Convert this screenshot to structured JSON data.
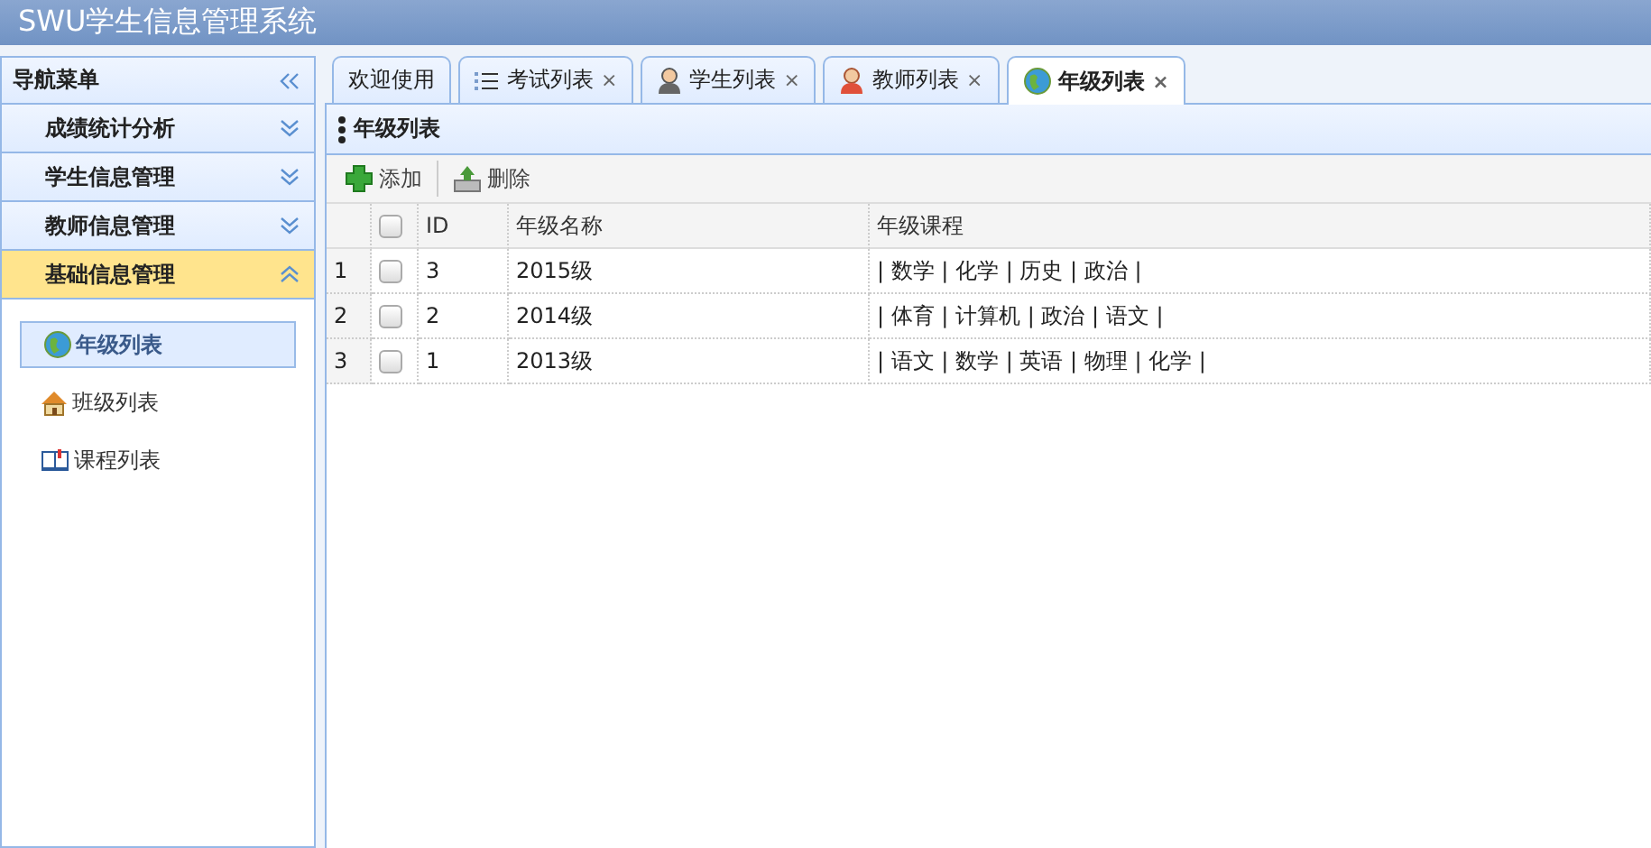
{
  "header": {
    "title": "SWU学生信息管理系统"
  },
  "nav": {
    "title": "导航菜单",
    "sections": [
      {
        "label": "成绩统计分析",
        "expanded": false
      },
      {
        "label": "学生信息管理",
        "expanded": false
      },
      {
        "label": "教师信息管理",
        "expanded": false
      },
      {
        "label": "基础信息管理",
        "expanded": true,
        "items": [
          {
            "label": "年级列表",
            "selected": true
          },
          {
            "label": "班级列表",
            "selected": false
          },
          {
            "label": "课程列表",
            "selected": false
          }
        ]
      }
    ]
  },
  "tabs": [
    {
      "label": "欢迎使用",
      "selected": false
    },
    {
      "label": "考试列表",
      "close": "×",
      "selected": false
    },
    {
      "label": "学生列表",
      "close": "×",
      "selected": false
    },
    {
      "label": "教师列表",
      "close": "×",
      "selected": false
    },
    {
      "label": "年级列表",
      "close": "×",
      "selected": true
    }
  ],
  "panel": {
    "title": "年级列表"
  },
  "toolbar": [
    {
      "label": "添加",
      "kind": "add"
    },
    {
      "label": "删除",
      "kind": "delete"
    }
  ],
  "table": {
    "select_all_checked": false,
    "columns": [
      "ID",
      "年级名称",
      "年级课程"
    ],
    "rows": [
      {
        "number": "1",
        "checked": false,
        "cells": [
          "3",
          "2015级",
          "| 数学 | 化学 | 历史 | 政治 |"
        ]
      },
      {
        "number": "2",
        "checked": false,
        "cells": [
          "2",
          "2014级",
          "| 体育 | 计算机 | 政治 | 语文 |"
        ]
      },
      {
        "number": "3",
        "checked": false,
        "cells": [
          "1",
          "2013级",
          "| 语文 | 数学 | 英语 | 物理 | 化学 |"
        ]
      }
    ]
  }
}
